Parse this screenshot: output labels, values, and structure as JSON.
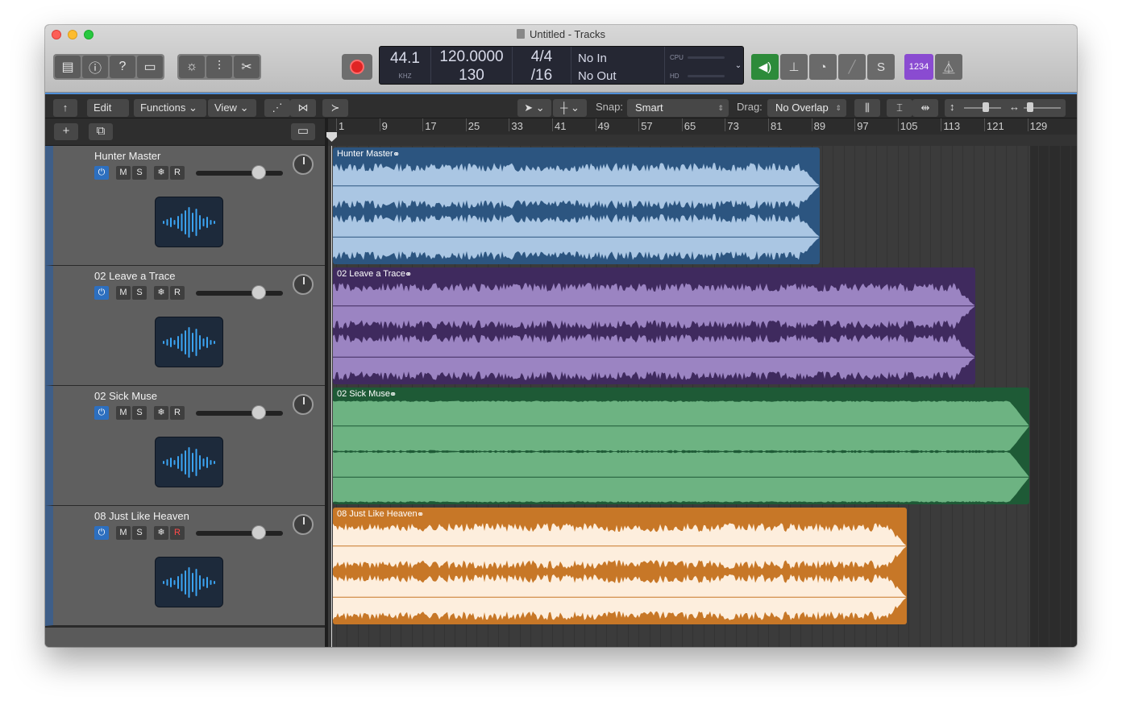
{
  "window": {
    "title": "Untitled - Tracks"
  },
  "lcd": {
    "sample_rate": "44.1",
    "sample_rate_unit": "KHZ",
    "tempo": "120.0000",
    "key_or_bar": "130",
    "time_sig_top": "4/4",
    "time_sig_bottom": "/16",
    "in_label": "No In",
    "out_label": "No Out",
    "cpu_label": "CPU",
    "hd_label": "HD"
  },
  "lcd_display_label": "1234",
  "editor": {
    "edit_menu": "Edit",
    "functions_menu": "Functions",
    "view_menu": "View",
    "snap_label": "Snap:",
    "snap_value": "Smart",
    "drag_label": "Drag:",
    "drag_value": "No Overlap"
  },
  "ruler": {
    "bars": [
      "1",
      "9",
      "17",
      "25",
      "33",
      "41",
      "49",
      "57",
      "65",
      "73",
      "81",
      "89",
      "97",
      "105",
      "113",
      "121",
      "129"
    ]
  },
  "tracks": [
    {
      "name": "Hunter Master",
      "region_name": "Hunter Master",
      "color": "#2c5580",
      "fill": "#aac6e3",
      "wave": "#2c5580",
      "record_armed": false
    },
    {
      "name": "02 Leave a Trace",
      "region_name": "02 Leave a Trace",
      "color": "#3f2a5e",
      "fill": "#9b84c2",
      "wave": "#3f2a5e",
      "record_armed": false
    },
    {
      "name": "02 Sick Muse",
      "region_name": "02 Sick Muse",
      "color": "#1e5a36",
      "fill": "#6db382",
      "wave": "#1e5a36",
      "record_armed": false
    },
    {
      "name": "08 Just Like Heaven",
      "region_name": "08 Just Like Heaven",
      "color": "#c77727",
      "fill": "#fdeedd",
      "wave": "#c77727",
      "record_armed": true
    }
  ],
  "track_buttons": {
    "mute": "M",
    "solo": "S",
    "freeze": "❄",
    "record": "R"
  }
}
